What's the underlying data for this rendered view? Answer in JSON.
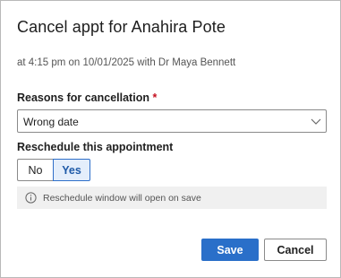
{
  "dialog": {
    "title": "Cancel appt for Anahira Pote",
    "subtitle": "at 4:15 pm on 10/01/2025 with Dr Maya Bennett"
  },
  "reason": {
    "label": "Reasons for cancellation",
    "required_marker": "*",
    "selected_value": "Wrong date",
    "icon": "chevron-down-icon"
  },
  "reschedule": {
    "label": "Reschedule this appointment",
    "options": [
      "No",
      "Yes"
    ],
    "selected": "Yes"
  },
  "info": {
    "icon": "info-icon",
    "text": "Reschedule window will open on save"
  },
  "actions": {
    "save_label": "Save",
    "cancel_label": "Cancel"
  },
  "colors": {
    "primary": "#2a6fc9",
    "required": "#c50f1f",
    "selected_bg": "#e4eefb"
  }
}
